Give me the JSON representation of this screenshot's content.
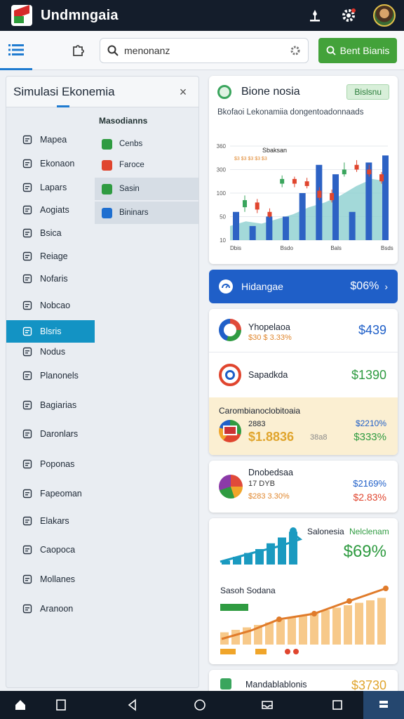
{
  "app": {
    "title": "Undmngaia"
  },
  "toolbar": {
    "search_value": "menonanz",
    "green_button": "Bent Bianis"
  },
  "panel": {
    "title": "Simulasi Ekonemia",
    "close": "×",
    "nav": [
      {
        "label": "Mapea",
        "icon": "clock-icon"
      },
      {
        "label": "Ekonaon",
        "icon": "document-icon"
      },
      {
        "label": "Lapars",
        "icon": "file-icon"
      },
      {
        "label": "Aogiats",
        "icon": "folder-icon"
      },
      {
        "label": "Bsica",
        "icon": "book-icon"
      },
      {
        "label": "Reiage",
        "icon": "calendar-icon"
      },
      {
        "label": "Nofaris",
        "icon": "clock-icon"
      },
      {
        "label": "Nobcao",
        "icon": "box-icon"
      },
      {
        "label": "Blsris",
        "icon": "chart-icon"
      },
      {
        "label": "Nodus",
        "icon": "link-icon"
      },
      {
        "label": "Planonels",
        "icon": "document-icon"
      },
      {
        "label": "Bagiarias",
        "icon": "bag-icon"
      },
      {
        "label": "Daronlars",
        "icon": "building-icon"
      },
      {
        "label": "Poponas",
        "icon": "list-icon"
      },
      {
        "label": "Fapeoman",
        "icon": "window-icon"
      },
      {
        "label": "Elakars",
        "icon": "pen-icon"
      },
      {
        "label": "Caopoca",
        "icon": "globe-icon"
      },
      {
        "label": "Mollanes",
        "icon": "monitor-icon"
      },
      {
        "label": "Aranoon",
        "icon": "people-icon"
      }
    ],
    "sub_heading": "Masodianns",
    "sub_items": [
      {
        "label": "Cenbs",
        "icon": "check-icon",
        "color": "#2f9b41"
      },
      {
        "label": "Faroce",
        "icon": "alert-icon",
        "color": "#e0452e"
      },
      {
        "label": "Sasin",
        "icon": "mail-icon",
        "color": "#2f9b41"
      },
      {
        "label": "Bininars",
        "icon": "chart-icon",
        "color": "#1f6fd0"
      }
    ]
  },
  "chart_card": {
    "title": "Bione nosia",
    "badge": "Bislsnu",
    "subtitle": "Bkofaoi Lekonamiia dongentoadonnaads"
  },
  "chart_data": {
    "type": "bar",
    "legend_label": "Sbaksan",
    "legend_sub": "$3 $3 $3 $3 $3",
    "yticks": [
      "360",
      "300",
      "100",
      "50",
      "10"
    ],
    "xticks": [
      "Dbis",
      "Bsdo",
      "Bals",
      "Bsds"
    ],
    "ylim": [
      0,
      400
    ],
    "bars": [
      120,
      60,
      100,
      100,
      200,
      320,
      280,
      120,
      330,
      360
    ],
    "area": [
      60,
      80,
      70,
      90,
      110,
      140,
      160,
      190,
      230,
      260,
      250
    ],
    "candles": [
      {
        "o": 140,
        "c": 170,
        "h": 190,
        "l": 120
      },
      {
        "o": 160,
        "c": 130,
        "h": 175,
        "l": 115
      },
      {
        "o": 120,
        "c": 100,
        "h": 135,
        "l": 95
      },
      {
        "o": 240,
        "c": 260,
        "h": 275,
        "l": 225
      },
      {
        "o": 260,
        "c": 240,
        "h": 270,
        "l": 225
      },
      {
        "o": 250,
        "c": 230,
        "h": 265,
        "l": 220
      },
      {
        "o": 210,
        "c": 180,
        "h": 225,
        "l": 170
      },
      {
        "o": 200,
        "c": 170,
        "h": 215,
        "l": 160
      },
      {
        "o": 280,
        "c": 300,
        "h": 330,
        "l": 270
      },
      {
        "o": 320,
        "c": 300,
        "h": 340,
        "l": 290
      },
      {
        "o": 300,
        "c": 280,
        "h": 320,
        "l": 270
      },
      {
        "o": 280,
        "c": 250,
        "h": 290,
        "l": 240
      }
    ]
  },
  "blue_bar": {
    "label": "Hidangae",
    "value": "$06%",
    "chevron": "›"
  },
  "list": {
    "row1": {
      "name": "Yhopelaoa",
      "sub": "$30 $ 3.33%",
      "value": "$439"
    },
    "row2": {
      "name": "Sapadkda",
      "value": "$1390"
    },
    "row3": {
      "header": "Carombianoclobitoaia",
      "sub1": "2883",
      "main": "$1.8836",
      "main_sub": "38a8",
      "val1": "$2210%",
      "val2": "$333%"
    }
  },
  "pie_card": {
    "name": "Dnobedsaa",
    "sub1": "17 DYB",
    "sub2": "$283 3.30%",
    "val1": "$2169%",
    "val2": "$2.83%"
  },
  "growth_card": {
    "label1": "Salonesia",
    "label2": "Nelclenam",
    "value": "$69%",
    "label3": "Sasoh Sodana",
    "bars_top": [
      10,
      20,
      30,
      40,
      55,
      70,
      85
    ],
    "bars_bottom": [
      25,
      30,
      35,
      40,
      45,
      50,
      55,
      60,
      65,
      70,
      75,
      80,
      85,
      90,
      95
    ]
  },
  "bottom_card": {
    "name": "Mandablablonis",
    "value": "$3730"
  },
  "bottom_nav": [
    "home-icon",
    "doc-icon",
    "back-icon",
    "circle-icon",
    "tray-icon",
    "square-icon",
    "stack-icon"
  ]
}
